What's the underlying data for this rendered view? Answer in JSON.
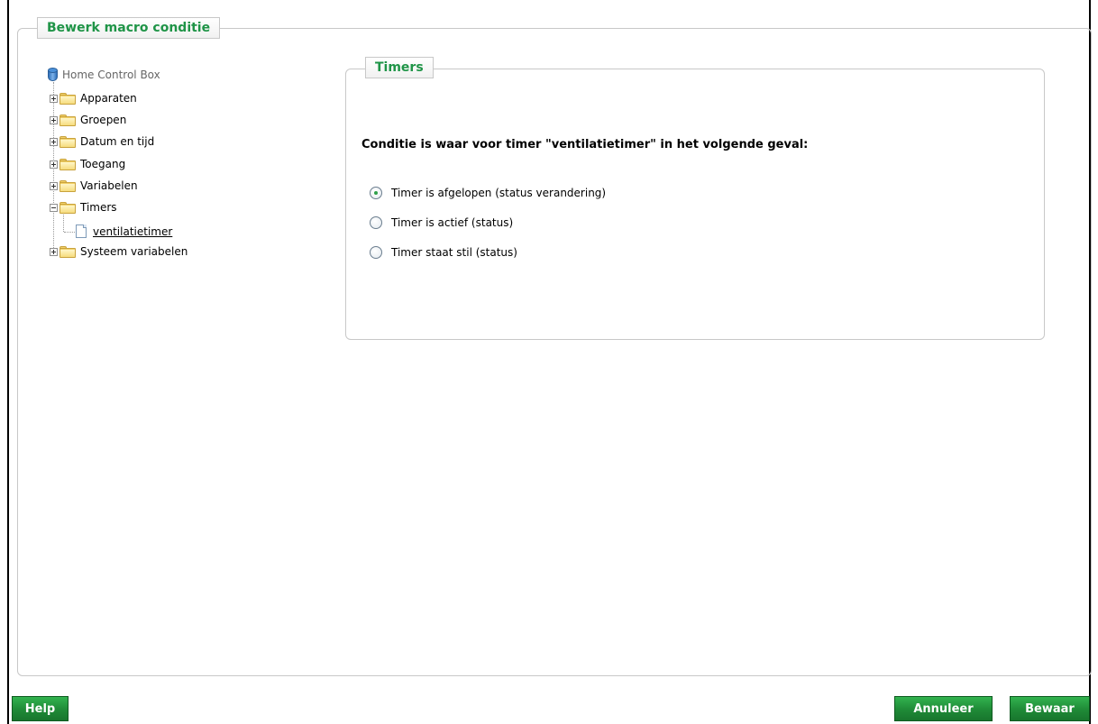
{
  "dialog": {
    "title": "Bewerk macro conditie"
  },
  "tree": {
    "root_label": "Home Control Box",
    "items": [
      {
        "label": "Apparaten",
        "expanded": false
      },
      {
        "label": "Groepen",
        "expanded": false
      },
      {
        "label": "Datum en tijd",
        "expanded": false
      },
      {
        "label": "Toegang",
        "expanded": false
      },
      {
        "label": "Variabelen",
        "expanded": false
      },
      {
        "label": "Timers",
        "expanded": true,
        "children": [
          {
            "label": "ventilatietimer",
            "selected": true
          }
        ]
      },
      {
        "label": "Systeem variabelen",
        "expanded": false
      }
    ]
  },
  "panel": {
    "title": "Timers",
    "question": "Conditie is waar voor timer \"ventilatietimer\" in het volgende geval:",
    "options": [
      {
        "label": "Timer is afgelopen (status verandering)",
        "checked": true
      },
      {
        "label": "Timer is actief (status)",
        "checked": false
      },
      {
        "label": "Timer staat stil (status)",
        "checked": false
      }
    ]
  },
  "buttons": {
    "help": "Help",
    "cancel": "Annuleer",
    "save": "Bewaar"
  },
  "colors": {
    "accent_green": "#1f9447",
    "button_green": "#1f8a37",
    "border_gray": "#c8c8c8"
  }
}
